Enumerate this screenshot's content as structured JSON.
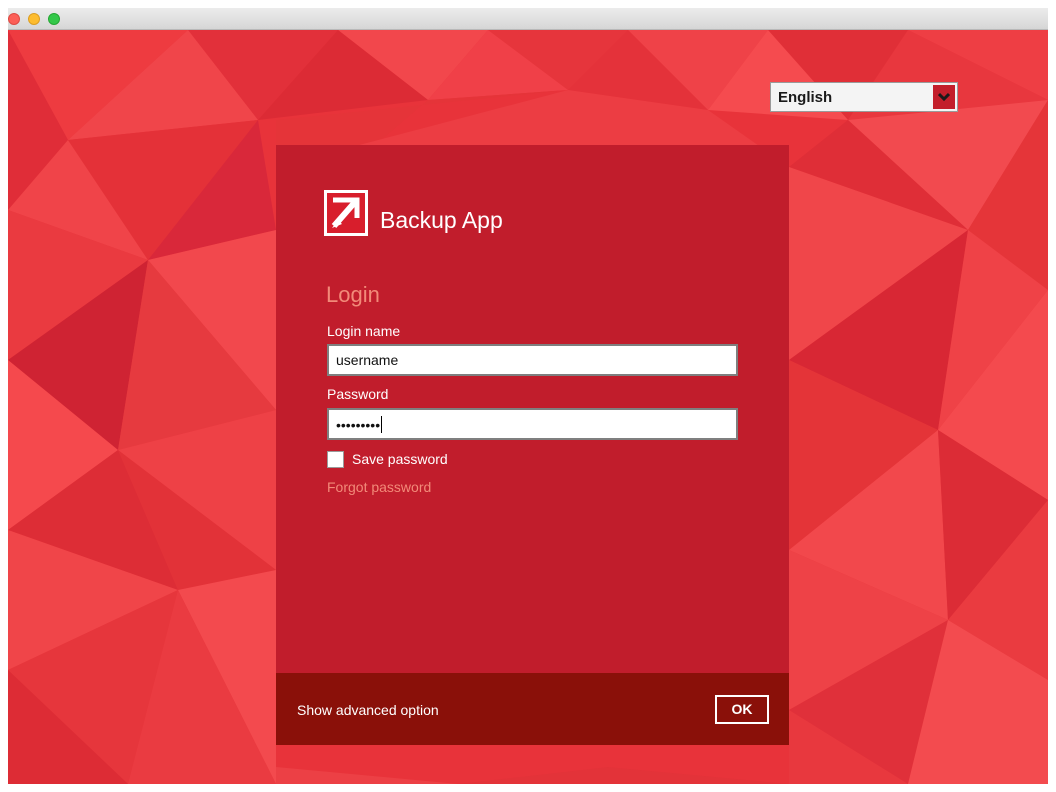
{
  "window": {
    "controls": [
      "close",
      "minimize",
      "zoom"
    ]
  },
  "language": {
    "selected": "English",
    "icon": "chevron-down-icon"
  },
  "app": {
    "name": "Backup App",
    "logo_icon": "arrow-up-right-logo"
  },
  "login": {
    "heading": "Login",
    "login_name_label": "Login name",
    "login_name_value": "username",
    "password_label": "Password",
    "password_value": "•••••••••",
    "save_password_label": "Save password",
    "save_password_checked": false,
    "forgot_password_link": "Forgot password"
  },
  "footer": {
    "advanced_link": "Show advanced option",
    "ok_label": "OK"
  },
  "colors": {
    "background": "#e8333a",
    "panel": "#c11d2c",
    "footer": "#8a1009",
    "accent_text": "#f28a79"
  }
}
